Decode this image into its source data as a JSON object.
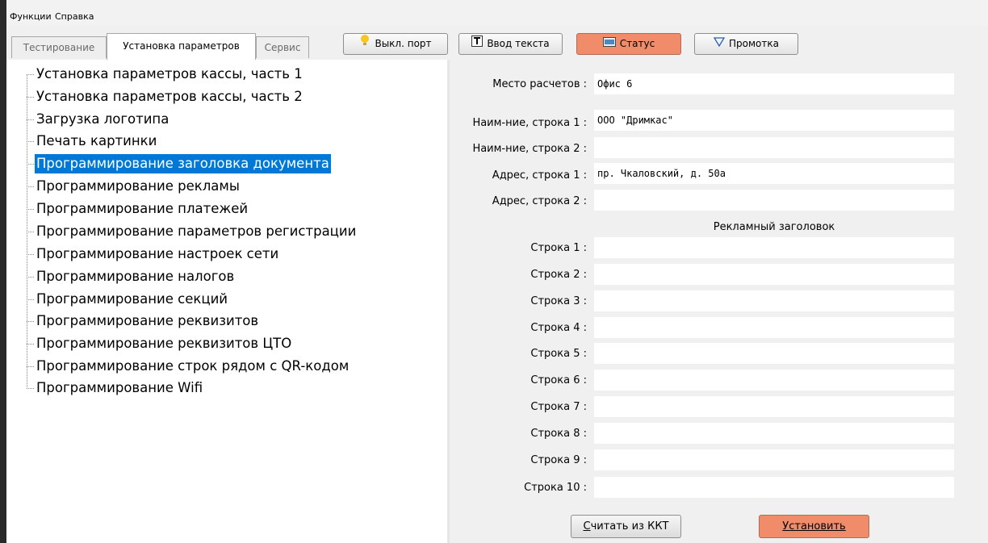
{
  "menu": {
    "functions": "Функции",
    "help": "Справка"
  },
  "tabs": [
    {
      "label": "Тестирование"
    },
    {
      "label": "Установка параметров"
    },
    {
      "label": "Сервис"
    }
  ],
  "toolbar": {
    "port_off": "Выкл. порт",
    "text_input": "Ввод текста",
    "status": "Статус",
    "feed": "Промотка"
  },
  "tree": {
    "items": [
      "Установка параметров кассы, часть 1",
      "Установка параметров кассы, часть 2",
      "Загрузка логотипа",
      "Печать картинки",
      "Программирование заголовка документа",
      "Программирование рекламы",
      "Программирование платежей",
      "Программирование параметров регистрации",
      "Программирование настроек сети",
      "Программирование налогов",
      "Программирование секций",
      "Программирование реквизитов",
      "Программирование реквизитов ЦТО",
      "Программирование строк рядом с QR-кодом",
      "Программирование Wifi"
    ],
    "selected": "Программирование заголовка документа"
  },
  "form": {
    "place_label": "Место расчетов :",
    "place_value": "Офис 6",
    "name1_label": "Наим-ние, строка 1 :",
    "name1_value": "ООО \"Дримкас\"",
    "name2_label": "Наим-ние, строка 2 :",
    "name2_value": "",
    "addr1_label": "Адрес, строка 1 :",
    "addr1_value": "пр. Чкаловский, д. 50а",
    "addr2_label": "Адрес, строка 2 :",
    "addr2_value": "",
    "ad_header": "Рекламный заголовок",
    "ad_lines": [
      {
        "label": "Строка 1 :",
        "value": ""
      },
      {
        "label": "Строка 2 :",
        "value": ""
      },
      {
        "label": "Строка 3 :",
        "value": ""
      },
      {
        "label": "Строка 4 :",
        "value": ""
      },
      {
        "label": "Строка 5 :",
        "value": ""
      },
      {
        "label": "Строка 6 :",
        "value": ""
      },
      {
        "label": "Строка 7 :",
        "value": ""
      },
      {
        "label": "Строка 8 :",
        "value": ""
      },
      {
        "label": "Строка 9 :",
        "value": ""
      },
      {
        "label": "Строка 10 :",
        "value": ""
      }
    ]
  },
  "buttons": {
    "read_prefix": "С",
    "read_rest": "читать из ККТ",
    "set_prefix": "У",
    "set_rest": "становить"
  },
  "colors": {
    "accent": "#f08c6a",
    "selection": "#0078d7"
  }
}
